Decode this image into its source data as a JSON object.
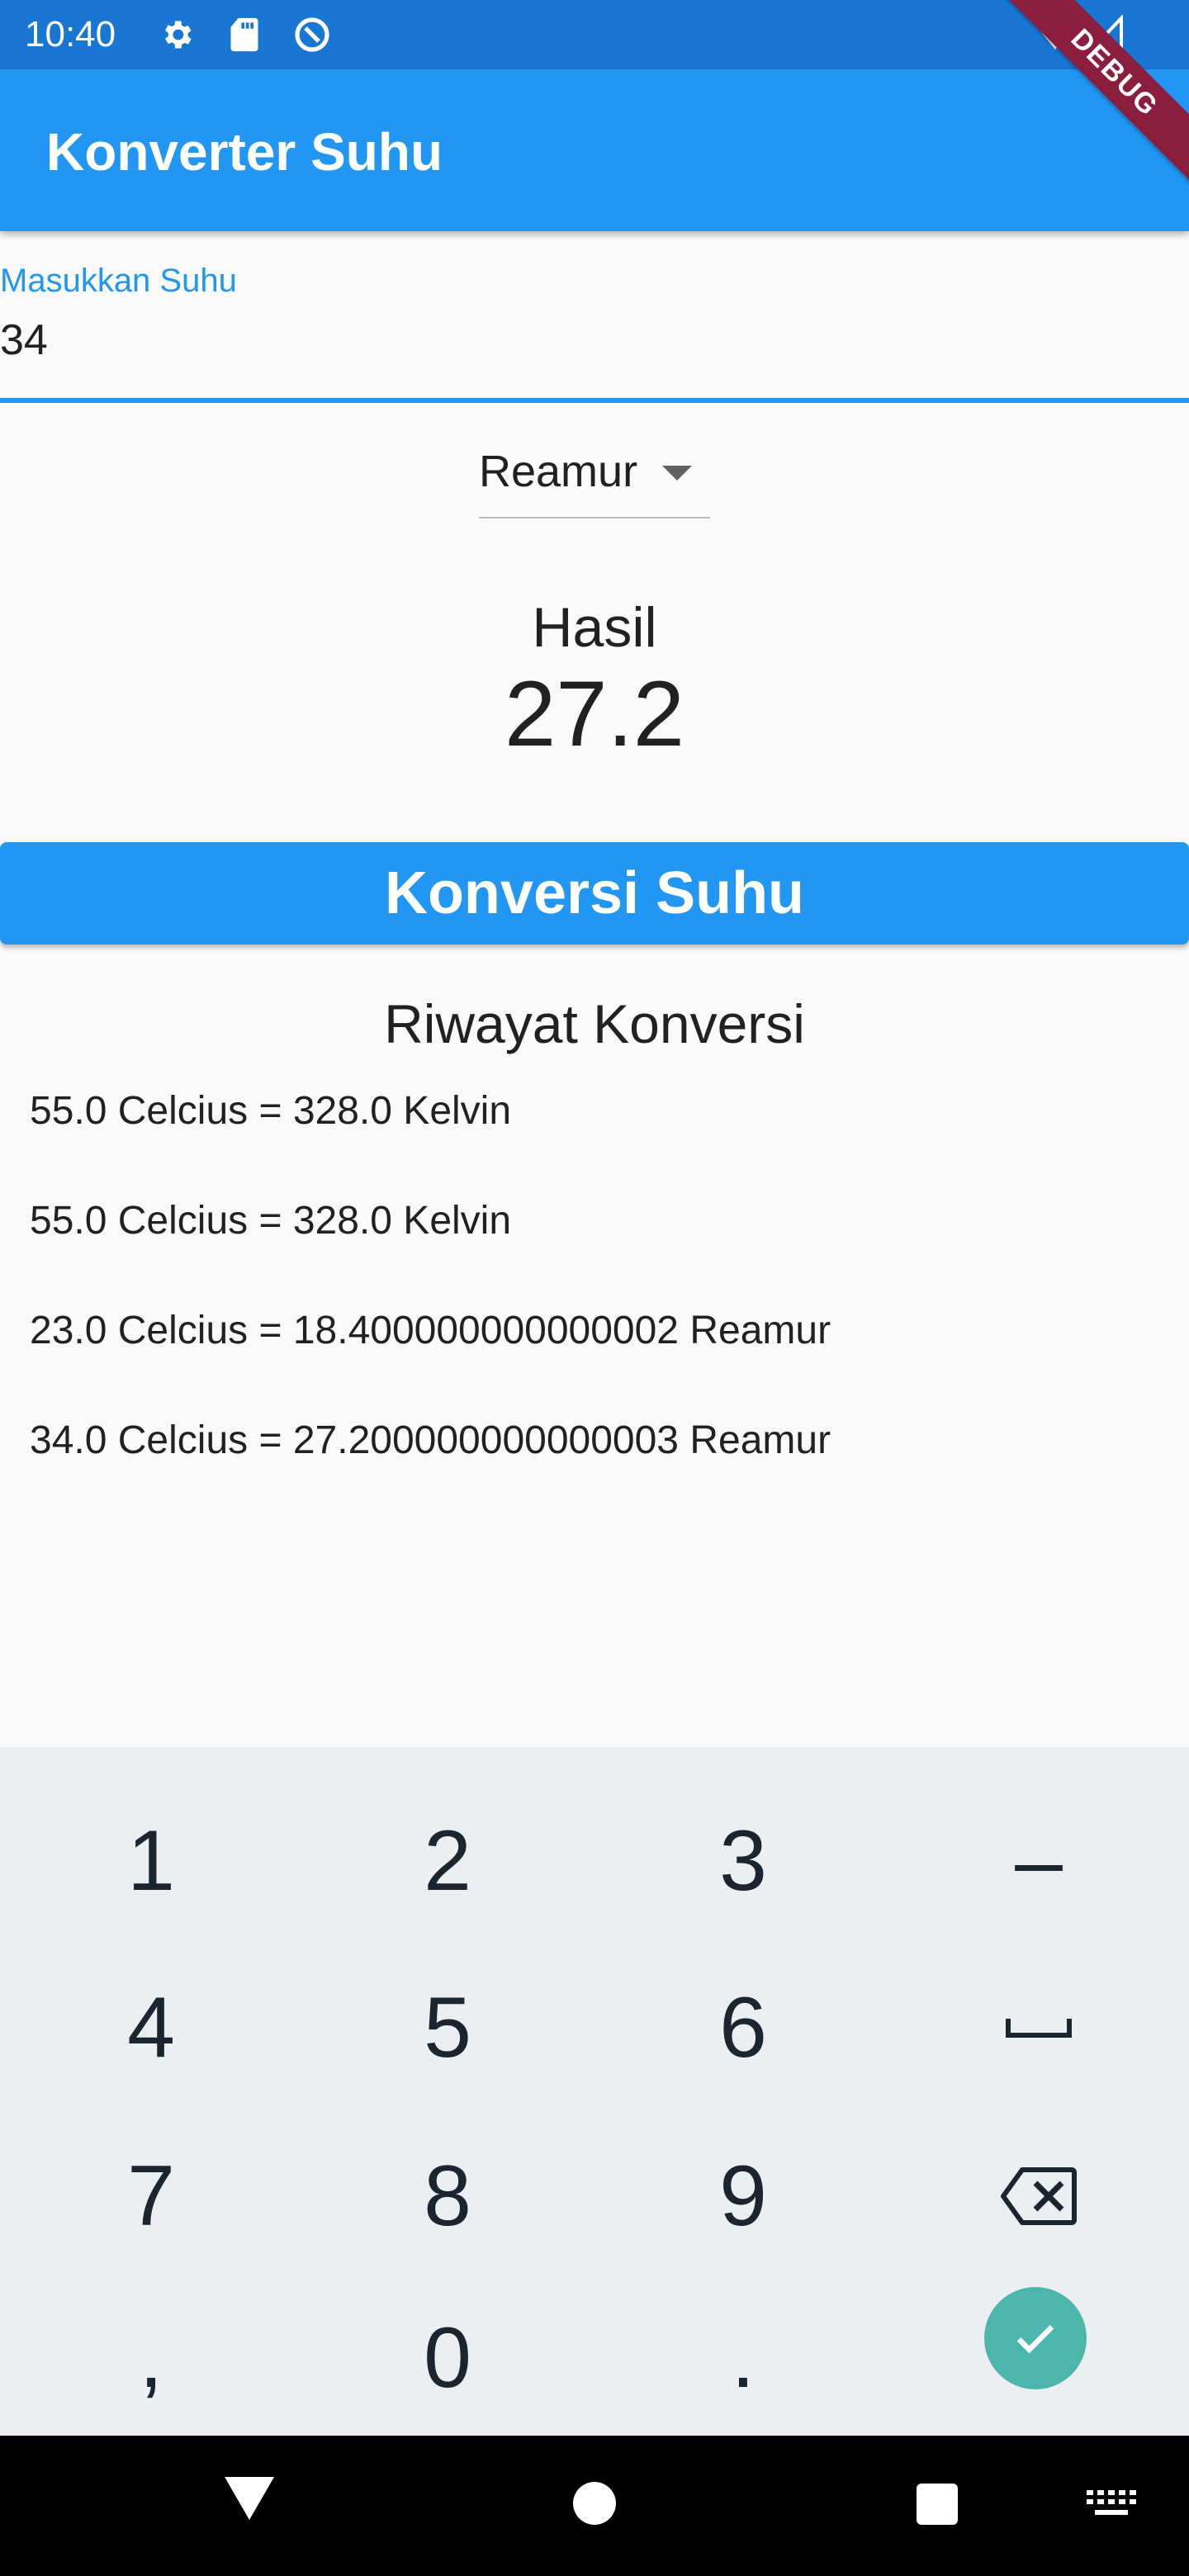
{
  "status_bar": {
    "time": "10:40",
    "icons": [
      "settings-icon",
      "sd-card-icon",
      "sync-icon",
      "wifi-icon",
      "signal-icon"
    ]
  },
  "debug_banner": "DEBUG",
  "app_bar": {
    "title": "Konverter Suhu"
  },
  "input": {
    "label": "Masukkan Suhu",
    "value": "34"
  },
  "dropdown": {
    "selected": "Reamur"
  },
  "result": {
    "label": "Hasil",
    "value": "27.2"
  },
  "convert_button": {
    "label": "Konversi Suhu"
  },
  "history": {
    "title": "Riwayat Konversi",
    "items": [
      "55.0 Celcius = 328.0 Kelvin",
      "55.0 Celcius = 328.0 Kelvin",
      "23.0 Celcius = 18.400000000000002 Reamur",
      "34.0 Celcius = 27.200000000000003 Reamur"
    ]
  },
  "keyboard": {
    "keys": [
      "1",
      "2",
      "3",
      "–",
      "4",
      "5",
      "6",
      "7",
      "8",
      "9",
      ",",
      "0",
      "."
    ]
  },
  "colors": {
    "primary": "#2196f3",
    "status_bar": "#1976d2",
    "debug_ribbon": "#8b1e3f",
    "keyboard_bg": "#eceff1",
    "done_key": "#4db6ac"
  }
}
